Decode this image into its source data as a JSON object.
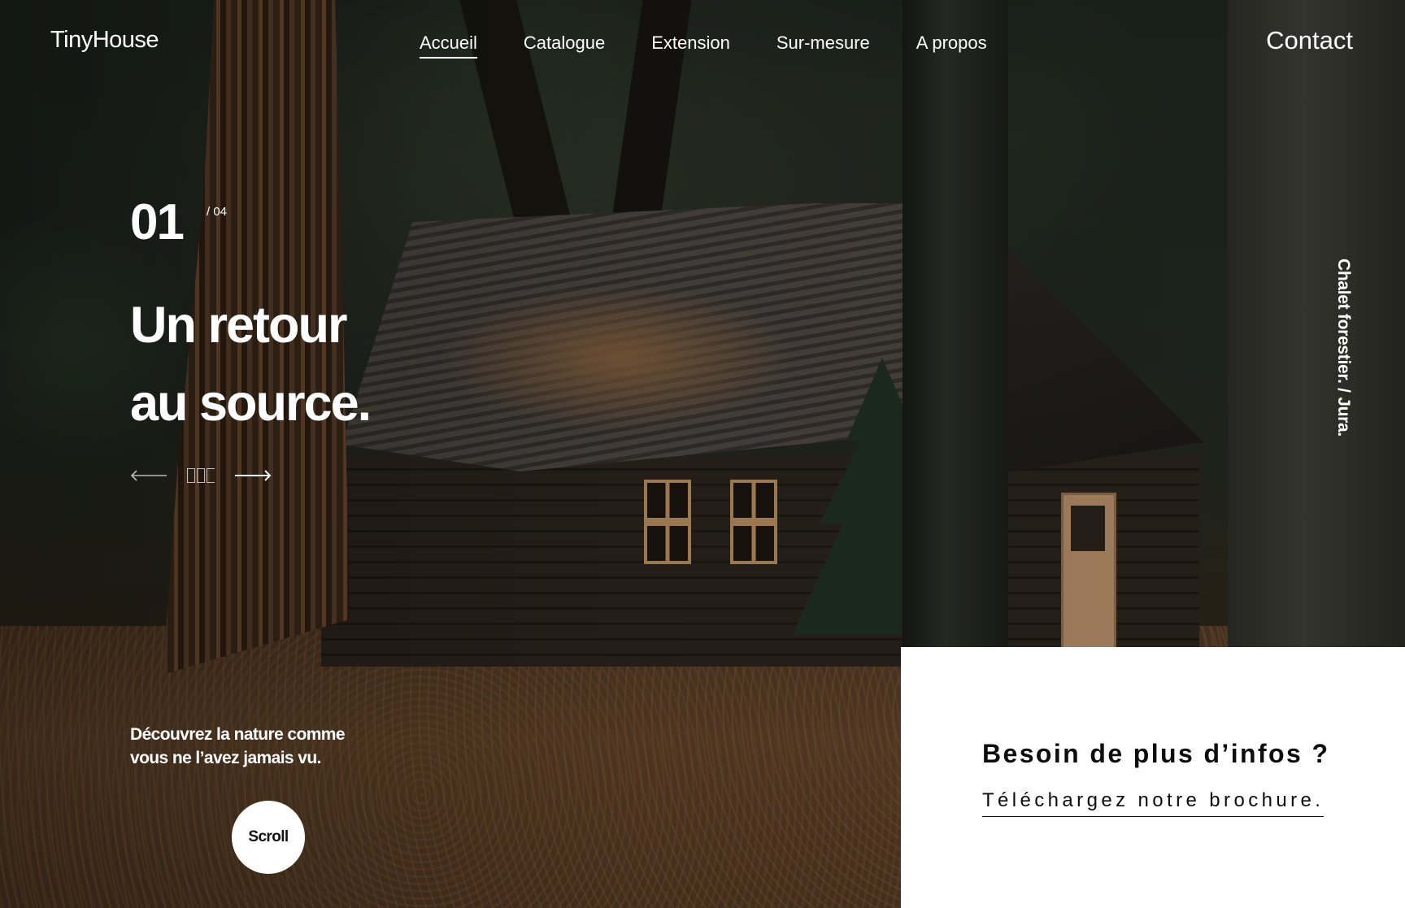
{
  "header": {
    "logo": "TinyHouse",
    "nav": [
      {
        "label": "Accueil",
        "active": true
      },
      {
        "label": "Catalogue",
        "active": false
      },
      {
        "label": "Extension",
        "active": false
      },
      {
        "label": "Sur-mesure",
        "active": false
      },
      {
        "label": "A propos",
        "active": false
      }
    ],
    "contact": "Contact"
  },
  "hero": {
    "slide_current": "01",
    "slide_total": "/ 04",
    "title_line1": "Un retour",
    "title_line2": "au source.",
    "tagline_line1": "Découvrez la nature comme",
    "tagline_line2": "vous ne l’avez jamais vu.",
    "scroll": "Scroll",
    "location": "Chalet forestier. / Jura.",
    "controls": {
      "prev_icon": "arrow-left-icon",
      "next_icon": "arrow-right-icon"
    }
  },
  "info": {
    "title": "Besoin de plus d’infos ?",
    "link": "Téléchargez notre brochure."
  },
  "colors": {
    "text": "#ffffff",
    "card_background": "#ffffff",
    "card_text": "#0d0d0d"
  }
}
